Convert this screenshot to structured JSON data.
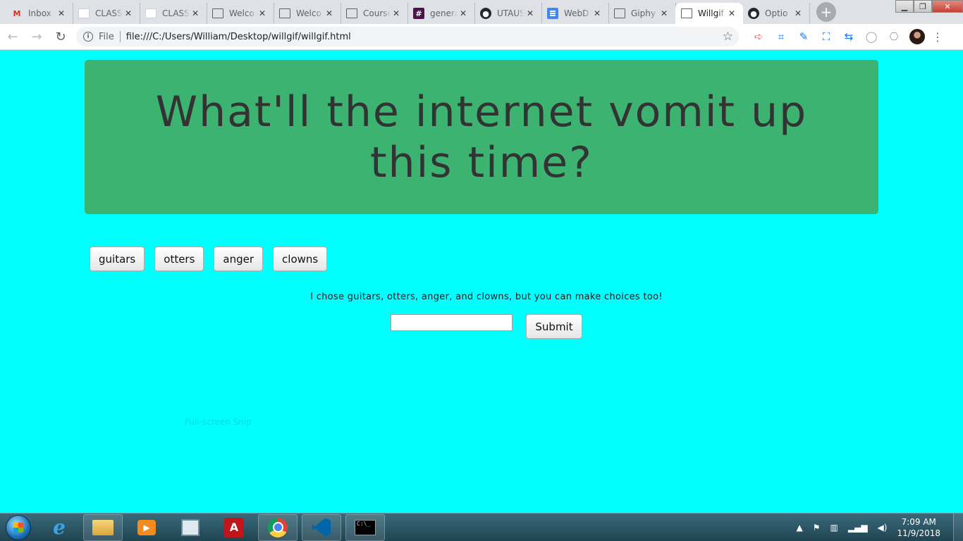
{
  "browser": {
    "tabs": [
      {
        "title": "Inbox",
        "icon": "gmail-icon",
        "glyph": "M"
      },
      {
        "title": "CLASS",
        "icon": "blank-page-icon",
        "glyph": ""
      },
      {
        "title": "CLASS",
        "icon": "blank-page-icon",
        "glyph": ""
      },
      {
        "title": "Welco",
        "icon": "document-icon",
        "glyph": ""
      },
      {
        "title": "Welco",
        "icon": "document-icon",
        "glyph": ""
      },
      {
        "title": "Course",
        "icon": "document-icon",
        "glyph": ""
      },
      {
        "title": "general",
        "icon": "slack-icon",
        "glyph": "#"
      },
      {
        "title": "UTAUS",
        "icon": "github-icon",
        "glyph": "●"
      },
      {
        "title": "WebD",
        "icon": "google-docs-icon",
        "glyph": ""
      },
      {
        "title": "Giphy",
        "icon": "document-icon",
        "glyph": ""
      },
      {
        "title": "Willgif",
        "icon": "document-icon",
        "glyph": "",
        "active": true
      },
      {
        "title": "Optio",
        "icon": "github-icon",
        "glyph": "●"
      }
    ],
    "tab_close_glyph": "✕",
    "new_tab_glyph": "+",
    "window_controls": {
      "minimize": "▁",
      "maximize": "❐",
      "close": "✕"
    },
    "nav": {
      "back": "←",
      "forward": "→",
      "reload": "↻"
    },
    "omnibox": {
      "info_glyph": "i",
      "scheme_label": "File",
      "url": "file:///C:/Users/William/Desktop/willgif/willgif.html",
      "star_glyph": "☆"
    },
    "extensions": [
      {
        "name": "ext-red-arrow-icon",
        "glyph": "➪",
        "tone": "red"
      },
      {
        "name": "ext-crop-icon",
        "glyph": "⌗",
        "tone": "blue"
      },
      {
        "name": "ext-pen-icon",
        "glyph": "✎",
        "tone": "blue"
      },
      {
        "name": "ext-fullscreen-icon",
        "glyph": "⛶",
        "tone": "blue"
      },
      {
        "name": "ext-swap-icon",
        "glyph": "⇆",
        "tone": "blue"
      },
      {
        "name": "ext-circle-icon",
        "glyph": "◯",
        "tone": "grey"
      },
      {
        "name": "ext-camera-icon",
        "glyph": "⎔",
        "tone": "grey"
      }
    ],
    "menu_glyph": "⋮"
  },
  "page": {
    "background": "#00ffff",
    "jumbotron_color": "#3cb371",
    "headline": "What'll the internet vomit up this time?",
    "topics": [
      "guitars",
      "otters",
      "anger",
      "clowns"
    ],
    "caption": "I chose guitars, otters, anger, and clowns, but you can make choices too!",
    "input_value": "",
    "submit_label": "Submit",
    "ghost_text": "Full-screen Snip"
  },
  "taskbar": {
    "apps": [
      {
        "name": "internet-explorer-icon",
        "glyph": "e"
      },
      {
        "name": "file-explorer-icon",
        "glyph": ""
      },
      {
        "name": "media-player-icon",
        "glyph": "▶"
      },
      {
        "name": "spreadsheet-icon",
        "glyph": ""
      },
      {
        "name": "acrobat-icon",
        "glyph": "A"
      },
      {
        "name": "chrome-icon",
        "glyph": ""
      },
      {
        "name": "vscode-icon",
        "glyph": ""
      },
      {
        "name": "command-prompt-icon",
        "glyph": "C:\\_"
      }
    ],
    "tray": {
      "chevron": "▲",
      "flag": "⚑",
      "network": "▥",
      "signal": "▂▄▆",
      "volume": "◀)"
    },
    "time": "7:09 AM",
    "date": "11/9/2018"
  }
}
